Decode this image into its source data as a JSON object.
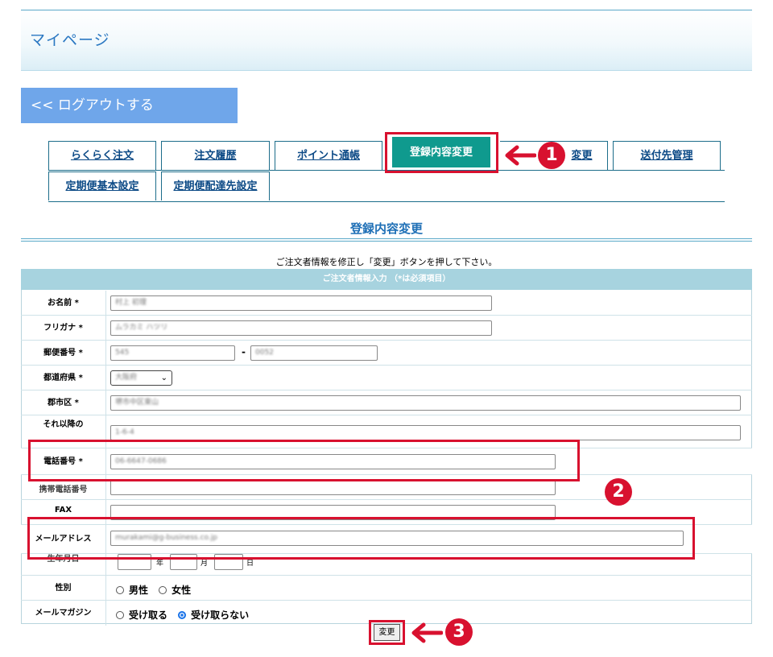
{
  "header": {
    "title": "マイページ"
  },
  "logout": {
    "label": "<< ログアウトする"
  },
  "tabs": {
    "rakuraku": "らくらく注文",
    "history": "注文履歴",
    "points": "ポイント通帳",
    "profile": "登録内容変更",
    "partial_change": "変更",
    "shipping": "送付先管理",
    "regular_basic": "定期便基本設定",
    "regular_delivery": "定期便配達先設定"
  },
  "section": {
    "title": "登録内容変更",
    "instruction": "ご注文者情報を修正し「変更」ボタンを押して下さい。",
    "table_header": "ご注文者情報入力 （*は必須項目）"
  },
  "form": {
    "name": {
      "label": "お名前 *",
      "value": "村上 初理"
    },
    "kana": {
      "label": "フリガナ *",
      "value": "ムラカミ ハツリ"
    },
    "postal": {
      "label": "郵便番号 *",
      "value1": "545",
      "sep": "-",
      "value2": "0052"
    },
    "prefecture": {
      "label": "都道府県 *",
      "value": "大阪府"
    },
    "city": {
      "label": "郡市区 *",
      "value": "堺市中区東山"
    },
    "address": {
      "label": "それ以降の",
      "value": "1-6-4"
    },
    "phone": {
      "label": "電話番号 *",
      "value": "06-6647-0686"
    },
    "mobile": {
      "label": "携帯電話番号"
    },
    "fax": {
      "label": "FAX"
    },
    "email": {
      "label": "メールアドレス",
      "value": "murakami@g-business.co.jp"
    },
    "birthday": {
      "label": "生年月日",
      "sep1": "年",
      "sep2": "月",
      "sep3": "日"
    },
    "gender": {
      "label": "性別",
      "male": "男性",
      "female": "女性"
    },
    "magazine": {
      "label": "メールマガジン",
      "receive": "受け取る",
      "decline": "受け取らない"
    }
  },
  "buttons": {
    "change": "変更"
  },
  "annotations": {
    "n1": "1",
    "n2": "2",
    "n3": "3"
  },
  "colors": {
    "accent_red": "#d8112f",
    "active_tab": "#0f9a8e",
    "header_blue": "#a7d3df"
  }
}
